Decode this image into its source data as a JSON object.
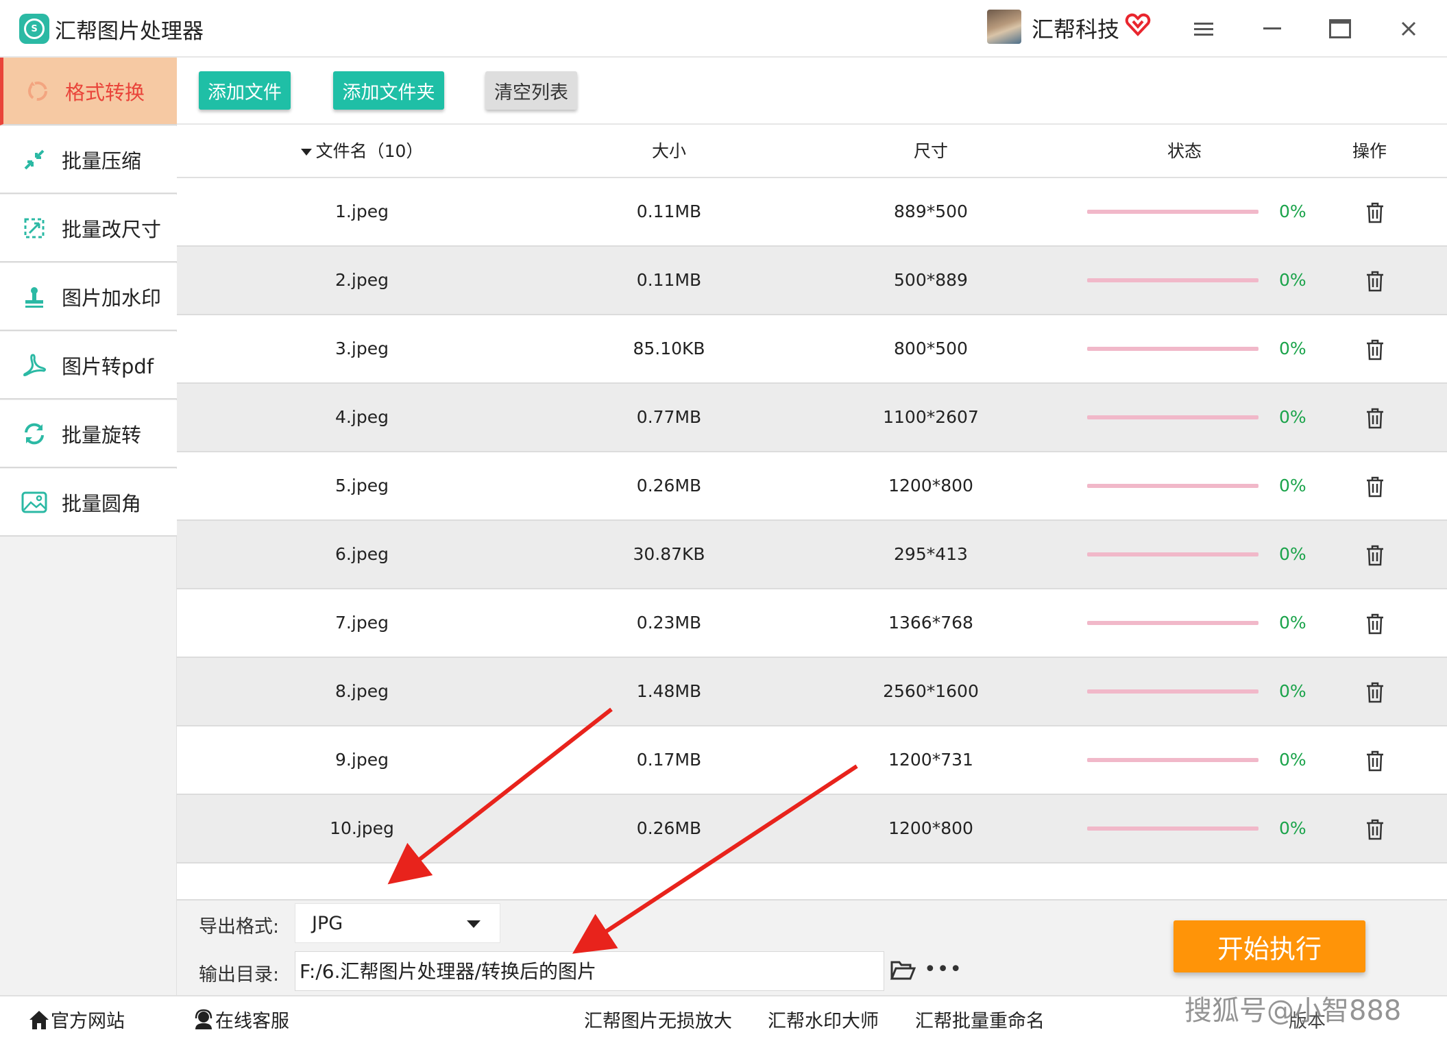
{
  "app": {
    "title": "汇帮图片处理器",
    "user_name": "汇帮科技"
  },
  "colors": {
    "accent_green": "#1fbfa6",
    "active_bg": "#f6c9a3",
    "active_text": "#e9443a",
    "progress_bar": "#f1b8c9",
    "progress_pct": "#1aa34a",
    "start_button": "#ff9408",
    "annotation_arrow": "#e8231c"
  },
  "window_controls": [
    "menu-icon",
    "minimize-icon",
    "maximize-icon",
    "close-icon"
  ],
  "sidebar": {
    "items": [
      {
        "label": "格式转换",
        "icon": "format-convert-icon",
        "active": true
      },
      {
        "label": "批量压缩",
        "icon": "compress-icon",
        "active": false
      },
      {
        "label": "批量改尺寸",
        "icon": "resize-icon",
        "active": false
      },
      {
        "label": "图片加水印",
        "icon": "watermark-stamp-icon",
        "active": false
      },
      {
        "label": "图片转pdf",
        "icon": "pdf-icon",
        "active": false
      },
      {
        "label": "批量旋转",
        "icon": "rotate-icon",
        "active": false
      },
      {
        "label": "批量圆角",
        "icon": "rounded-corner-icon",
        "active": false
      }
    ]
  },
  "toolbar": {
    "add_file": "添加文件",
    "add_folder": "添加文件夹",
    "clear_list": "清空列表"
  },
  "table": {
    "headers": {
      "filename": "文件名（10）",
      "size": "大小",
      "dimensions": "尺寸",
      "status": "状态",
      "action": "操作"
    },
    "rows": [
      {
        "name": "1.jpeg",
        "size": "0.11MB",
        "dim": "889*500",
        "progress": "0%"
      },
      {
        "name": "2.jpeg",
        "size": "0.11MB",
        "dim": "500*889",
        "progress": "0%"
      },
      {
        "name": "3.jpeg",
        "size": "85.10KB",
        "dim": "800*500",
        "progress": "0%"
      },
      {
        "name": "4.jpeg",
        "size": "0.77MB",
        "dim": "1100*2607",
        "progress": "0%"
      },
      {
        "name": "5.jpeg",
        "size": "0.26MB",
        "dim": "1200*800",
        "progress": "0%"
      },
      {
        "name": "6.jpeg",
        "size": "30.87KB",
        "dim": "295*413",
        "progress": "0%"
      },
      {
        "name": "7.jpeg",
        "size": "0.23MB",
        "dim": "1366*768",
        "progress": "0%"
      },
      {
        "name": "8.jpeg",
        "size": "1.48MB",
        "dim": "2560*1600",
        "progress": "0%"
      },
      {
        "name": "9.jpeg",
        "size": "0.17MB",
        "dim": "1200*731",
        "progress": "0%"
      },
      {
        "name": "10.jpeg",
        "size": "0.26MB",
        "dim": "1200*800",
        "progress": "0%"
      }
    ]
  },
  "output": {
    "format_label": "导出格式:",
    "format_value": "JPG",
    "dir_label": "输出目录:",
    "dir_value": "F:/6.汇帮图片处理器/转换后的图片",
    "start_button": "开始执行"
  },
  "footer": {
    "website": "官方网站",
    "support": "在线客服",
    "link1": "汇帮图片无损放大",
    "link2": "汇帮水印大师",
    "link3": "汇帮批量重命名",
    "watermark": "搜狐号@小智888",
    "version_partial": "版本"
  }
}
